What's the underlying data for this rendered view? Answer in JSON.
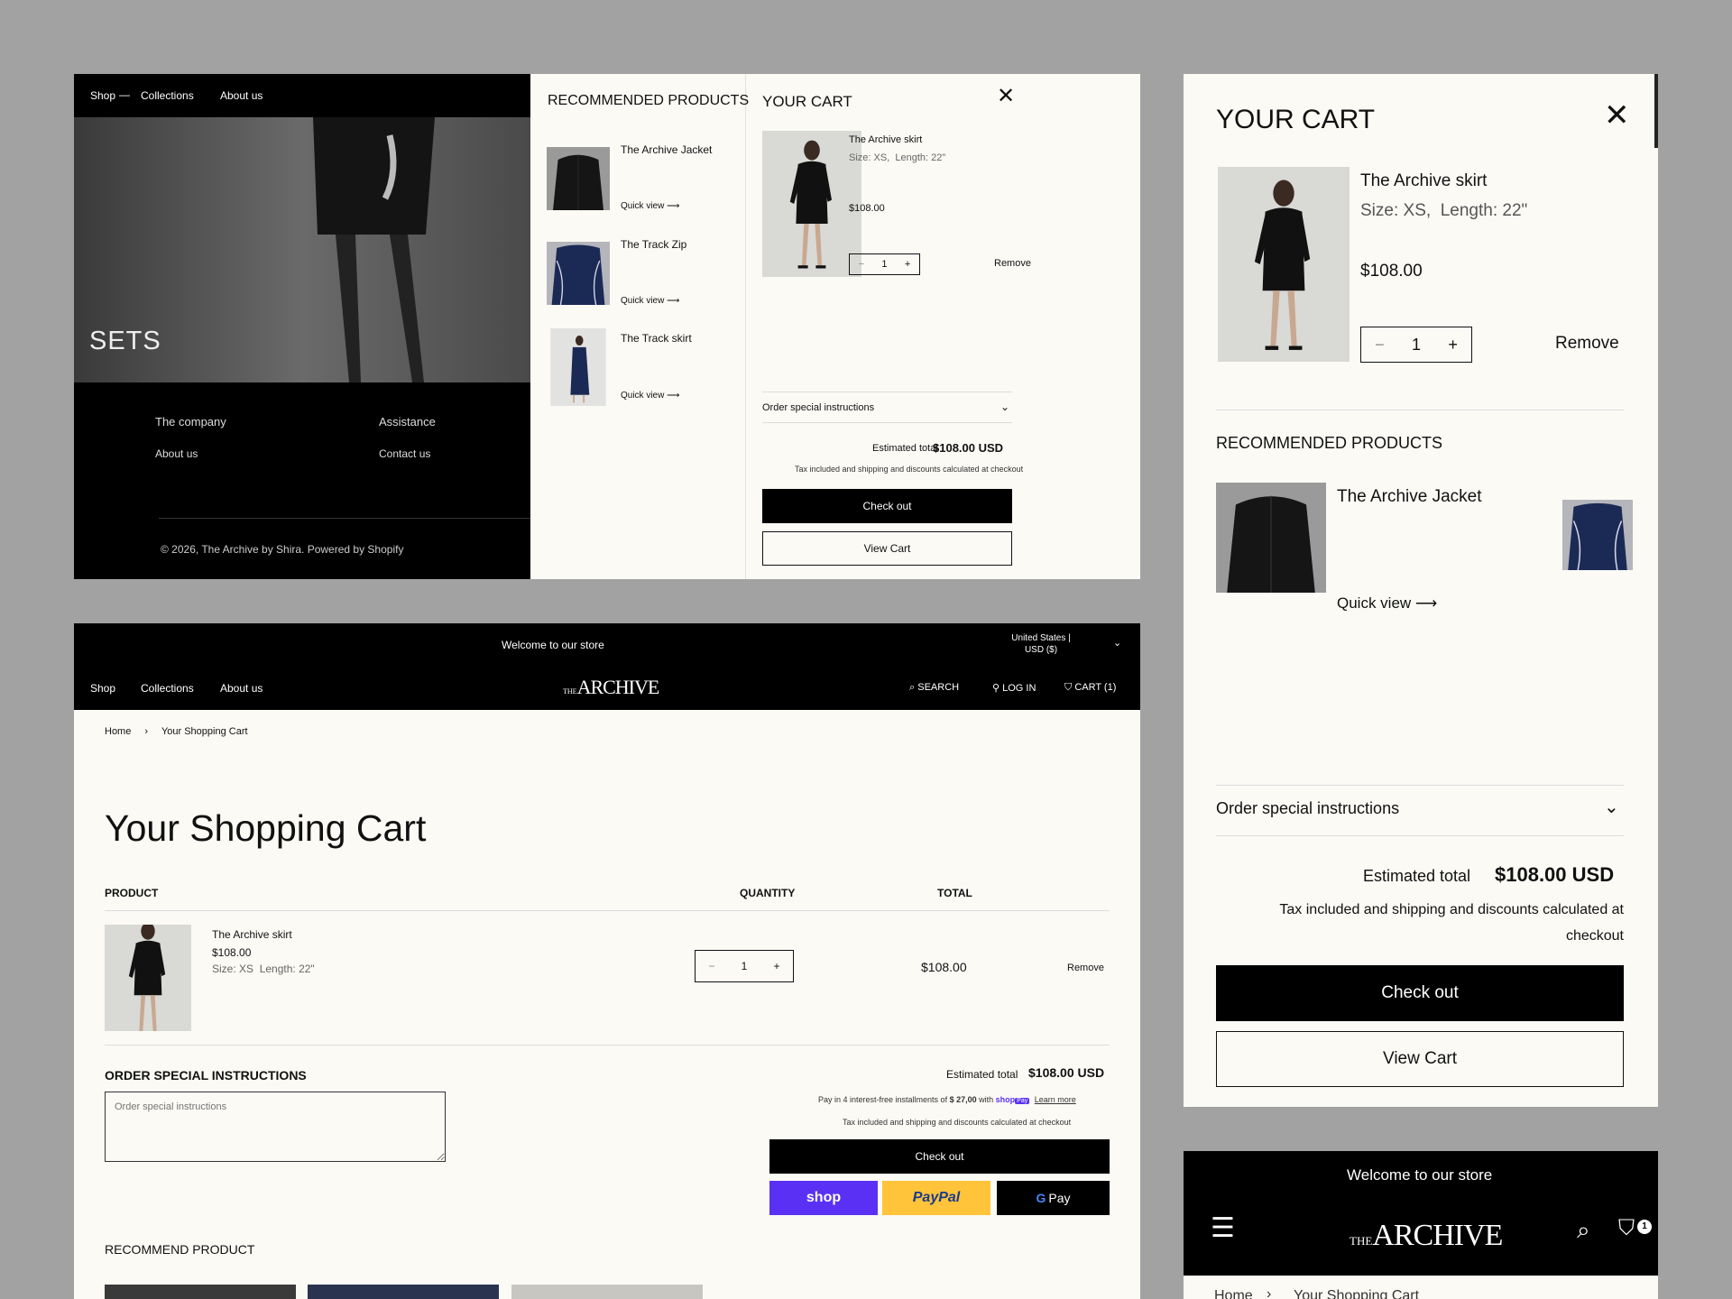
{
  "panel1": {
    "nav": [
      "Shop",
      "Collections",
      "About us"
    ],
    "hero_title": "SETS",
    "footer": {
      "col1_heading": "The company",
      "col1_link": "About us",
      "col2_heading": "Assistance",
      "col2_link": "Contact us",
      "copyright": "© 2026, The Archive by Shira. Powered by Shopify"
    },
    "recommended": {
      "heading": "RECOMMENDED PRODUCTS",
      "items": [
        {
          "name": "The Archive Jacket",
          "quick": "Quick view"
        },
        {
          "name": "The Track Zip",
          "quick": "Quick view"
        },
        {
          "name": "The Track skirt",
          "quick": "Quick view"
        }
      ]
    },
    "cart": {
      "heading": "YOUR CART",
      "item_name": "The Archive skirt",
      "item_size": "Size: XS,",
      "item_length": "Length: 22\"",
      "item_price": "$108.00",
      "qty": "1",
      "remove": "Remove",
      "instructions": "Order special instructions",
      "est_label": "Estimated total",
      "est_value": "$108.00 USD",
      "tax": "Tax included and shipping and discounts calculated at checkout",
      "checkout": "Check out",
      "view_cart": "View Cart"
    }
  },
  "panel2": {
    "announcement": "Welcome to our store",
    "currency": "United States | USD ($)",
    "nav": [
      "Shop",
      "Collections",
      "About us"
    ],
    "logo_prefix": "THE",
    "logo_main": "ARCHIVE",
    "search": "SEARCH",
    "login": "LOG IN",
    "cart": "CART (1)",
    "breadcrumb_home": "Home",
    "breadcrumb_current": "Your Shopping Cart",
    "page_title": "Your Shopping Cart",
    "col_product": "PRODUCT",
    "col_quantity": "QUANTITY",
    "col_total": "TOTAL",
    "item_name": "The Archive skirt",
    "item_price": "$108.00",
    "item_size": "Size: XS",
    "item_length": "Length: 22\"",
    "qty": "1",
    "line_total": "$108.00",
    "remove": "Remove",
    "instructions_heading": "ORDER SPECIAL INSTRUCTIONS",
    "instructions_placeholder": "Order special instructions",
    "est_label": "Estimated total",
    "est_value": "$108.00 USD",
    "installments_pre": "Pay in 4 interest-free installments of",
    "installments_amount": "$ 27,00",
    "installments_with": "with",
    "shop_pay": "shop",
    "shop_pay_badge": "Pay",
    "learn_more": "Learn more",
    "tax": "Tax included and shipping and discounts calculated at checkout",
    "checkout": "Check out",
    "pay_shop": "shop",
    "pay_paypal": "PayPal",
    "pay_gpay": "Pay",
    "recommend_heading": "RECOMMEND PRODUCT"
  },
  "panel3": {
    "heading": "YOUR CART",
    "item_name": "The Archive skirt",
    "item_size": "Size: XS,",
    "item_length": "Length: 22\"",
    "item_price": "$108.00",
    "qty": "1",
    "remove": "Remove",
    "rec_heading": "RECOMMENDED PRODUCTS",
    "rec_item": "The Archive Jacket",
    "rec_quick": "Quick view",
    "instructions": "Order special instructions",
    "est_label": "Estimated total",
    "est_value": "$108.00 USD",
    "tax": "Tax included and shipping and discounts calculated at checkout",
    "checkout": "Check out",
    "view_cart": "View Cart"
  },
  "panel4": {
    "announcement": "Welcome to our store",
    "logo_prefix": "THE",
    "logo_main": "ARCHIVE",
    "cart_count": "1",
    "breadcrumb_home": "Home",
    "breadcrumb_current": "Your Shopping Cart"
  }
}
